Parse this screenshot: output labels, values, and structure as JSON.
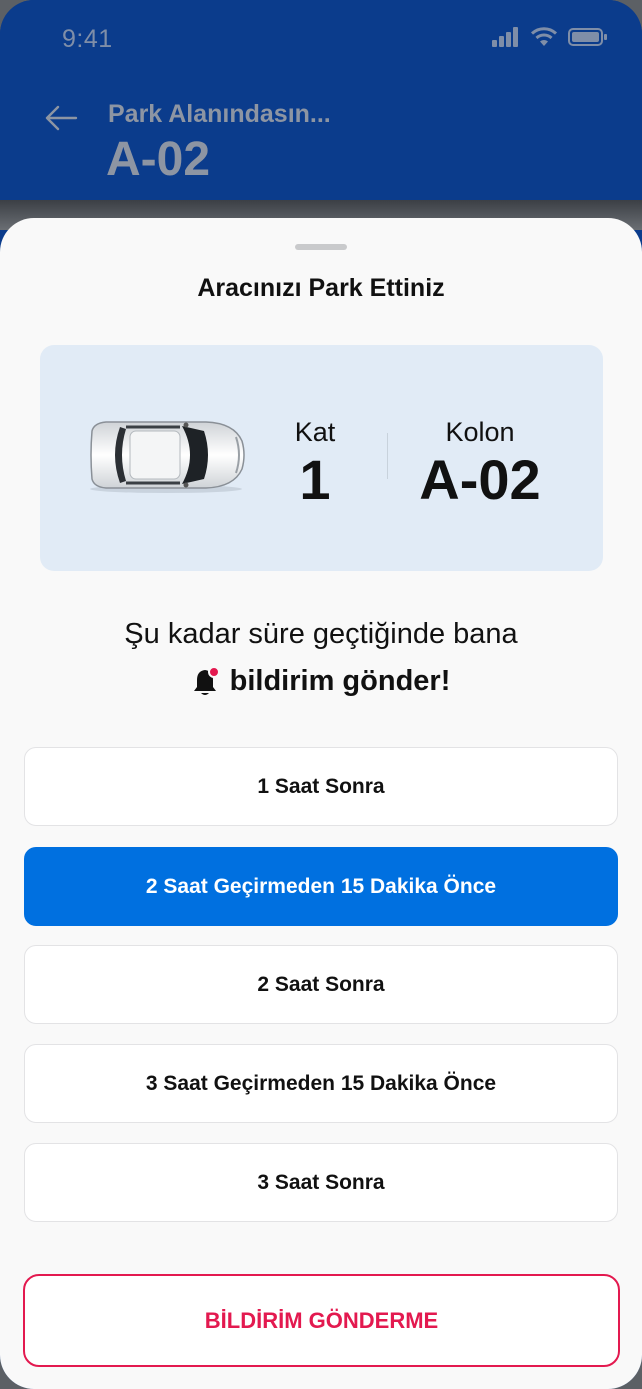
{
  "status_bar": {
    "time": "9:41"
  },
  "header": {
    "subtitle": "Park Alanındasın...",
    "title": "A-02",
    "back_icon": "arrow-left-icon"
  },
  "sheet": {
    "title": "Aracınızı Park Ettiniz",
    "info": {
      "car_icon": "car-top-view-icon",
      "kat_label": "Kat",
      "kat_value": "1",
      "kolon_label": "Kolon",
      "kolon_value": "A-02"
    },
    "prompt": {
      "line1": "Şu kadar süre geçtiğinde bana",
      "line2": "bildirim gönder!",
      "bell_icon": "bell-notification-icon"
    },
    "options": [
      {
        "label": "1 Saat Sonra",
        "selected": false
      },
      {
        "label": "2 Saat Geçirmeden 15 Dakika Önce",
        "selected": true
      },
      {
        "label": "2 Saat Sonra",
        "selected": false
      },
      {
        "label": "3 Saat Geçirmeden 15 Dakika Önce",
        "selected": false
      },
      {
        "label": "3 Saat Sonra",
        "selected": false
      }
    ],
    "cancel_label": "BİLDİRİM GÖNDERME"
  },
  "colors": {
    "header_bg": "#0b3c8c",
    "card_bg": "#e1ebf6",
    "accent": "#0070e0",
    "danger": "#e3194f"
  }
}
